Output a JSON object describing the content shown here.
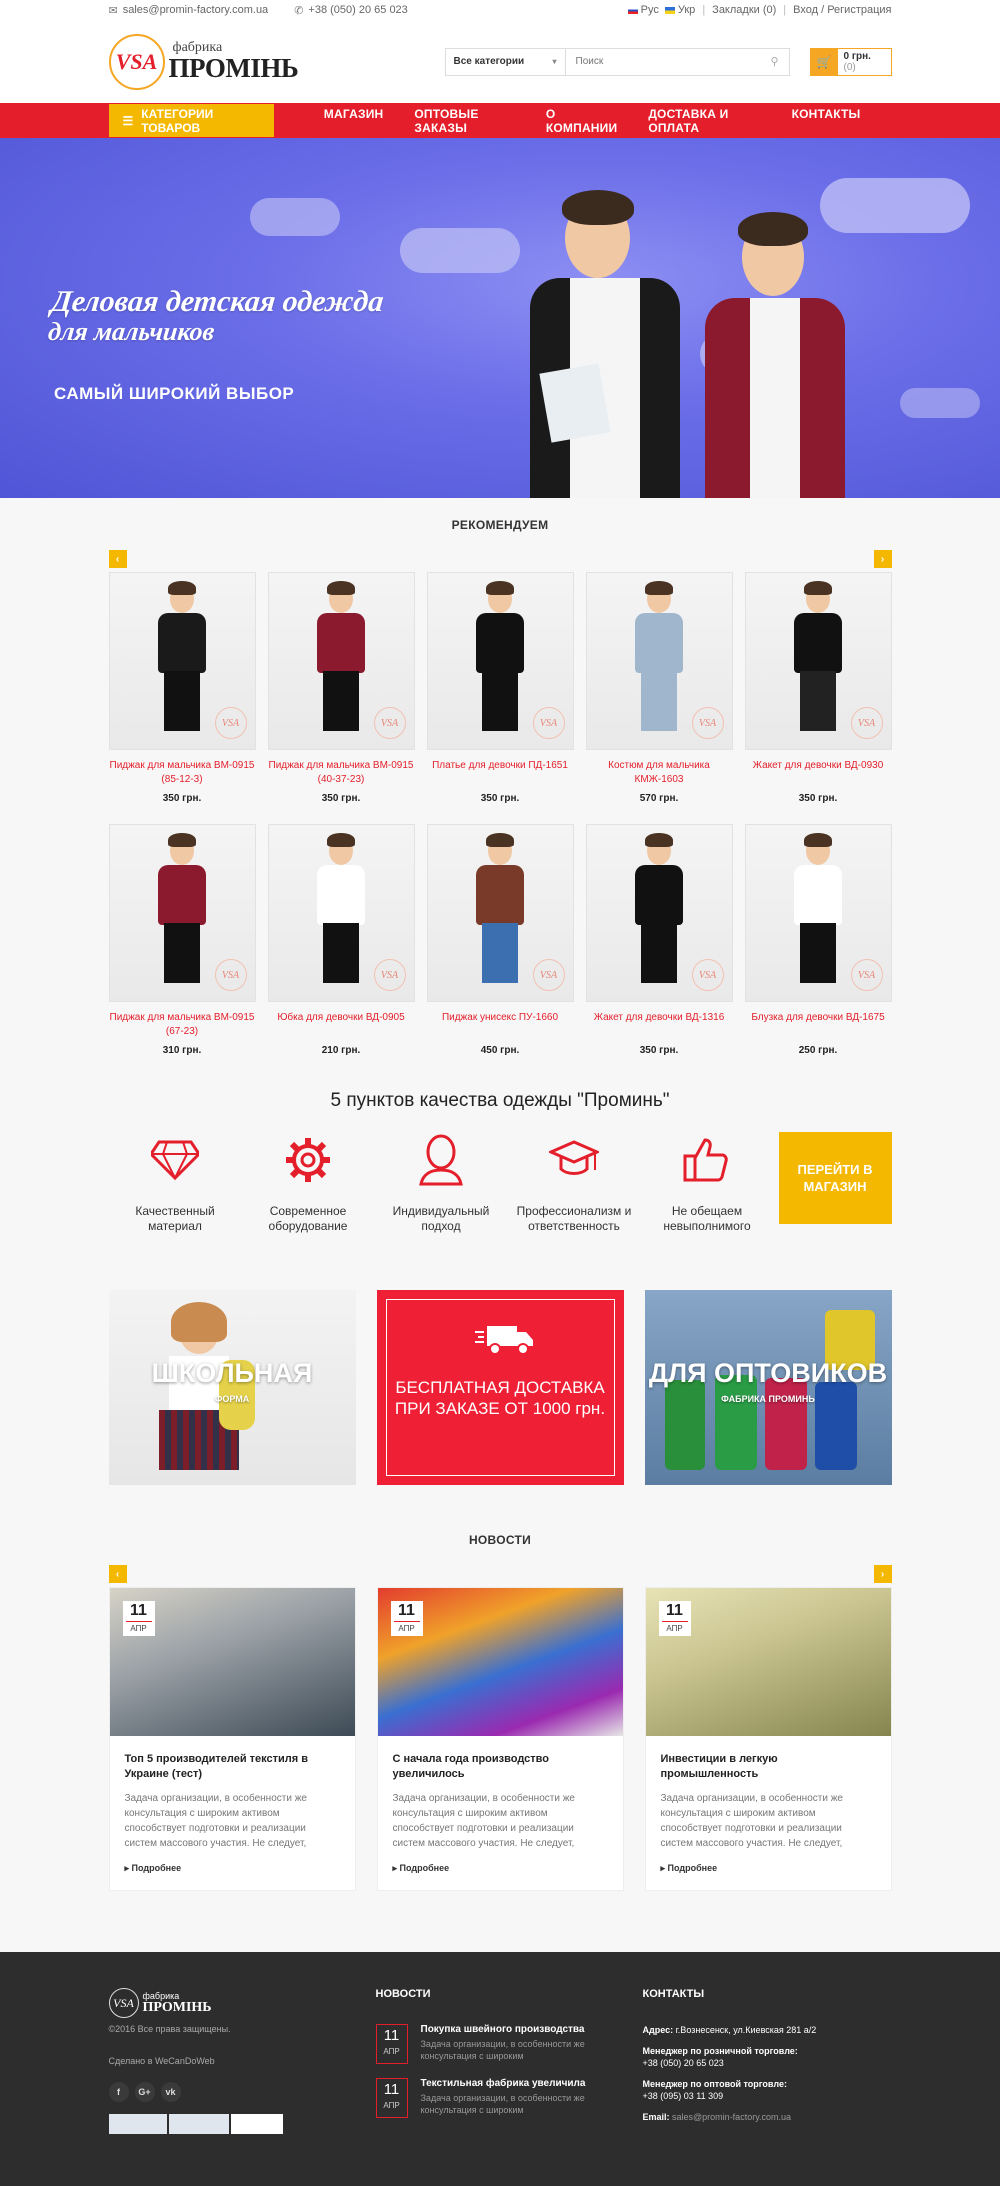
{
  "topbar": {
    "email": "sales@promin-factory.com.ua",
    "phone": "+38 (050) 20 65 023",
    "lang_ru": "Рус",
    "lang_ua": "Укр",
    "bookmarks": "Закладки (0)",
    "login": "Вход / Регистрация"
  },
  "header": {
    "logo_mark": "VSA",
    "logo_small": "фабрика",
    "logo_big": "ПРОМІНЬ",
    "search_category": "Все категории",
    "search_placeholder": "Поиск",
    "cart_total": "0 грн.",
    "cart_count": "(0)"
  },
  "nav": {
    "categories_label": "КАТЕГОРИИ ТОВАРОВ",
    "items": [
      "МАГАЗИН",
      "ОПТОВЫЕ ЗАКАЗЫ",
      "О КОМПАНИИ",
      "ДОСТАВКА И ОПЛАТА",
      "КОНТАКТЫ"
    ]
  },
  "hero": {
    "title_line1": "Деловая детская одежда",
    "title_line2": "для мальчиков",
    "subtitle": "САМЫЙ ШИРОКИЙ ВЫБОР"
  },
  "recommend": {
    "title": "РЕКОМЕНДУЕМ",
    "products": [
      {
        "name": "Пиджак для мальчика ВМ-0915 (85-12-3)",
        "price": "350 грн."
      },
      {
        "name": "Пиджак для мальчика ВМ-0915 (40-37-23)",
        "price": "350 грн."
      },
      {
        "name": "Платье для девочки ПД-1651",
        "price": "350 грн."
      },
      {
        "name": "Костюм для мальчика КМЖ-1603",
        "price": "570 грн."
      },
      {
        "name": "Жакет для девочки ВД-0930",
        "price": "350 грн."
      },
      {
        "name": "Пиджак для мальчика ВМ-0915 (67-23)",
        "price": "310 грн."
      },
      {
        "name": "Юбка для девочки ВД-0905",
        "price": "210 грн."
      },
      {
        "name": "Пиджак унисекс ПУ-1660",
        "price": "450 грн."
      },
      {
        "name": "Жакет для девочки ВД-1316",
        "price": "350 грн."
      },
      {
        "name": "Блузка для девочки ВД-1675",
        "price": "250 грн."
      }
    ]
  },
  "quality": {
    "title": "5 пунктов качества одежды \"Проминь\"",
    "items": [
      {
        "label": "Качественный материал",
        "icon": "diamond-icon"
      },
      {
        "label": "Современное оборудование",
        "icon": "gear-icon"
      },
      {
        "label": "Индивидуальный подход",
        "icon": "person-icon"
      },
      {
        "label": "Профессионализм и ответственность",
        "icon": "graduation-cap-icon"
      },
      {
        "label": "Не обещаем невыполнимого",
        "icon": "thumbs-up-icon"
      }
    ],
    "button": "ПЕРЕЙТИ В МАГАЗИН"
  },
  "banners": {
    "school_big": "ШКОЛЬНАЯ",
    "school_small": "ФОРМА",
    "delivery": "БЕСПЛАТНАЯ ДОСТАВКА ПРИ ЗАКАЗЕ ОТ 1000 грн.",
    "wholesale_big": "ДЛЯ ОПТОВИКОВ",
    "wholesale_small": "ФАБРИКА ПРОМИНЬ"
  },
  "news": {
    "title": "НОВОСТИ",
    "items": [
      {
        "day": "11",
        "month": "АПР",
        "title": "Топ 5 производителей текстиля в Украине (тест)",
        "text": "Задача организации, в особенности же консультация с широким активом способствует подготовки и реализации систем массового участия. Не следует, однако забывать,",
        "more": "Подробнее"
      },
      {
        "day": "11",
        "month": "АПР",
        "title": "С начала года производство увеличилось",
        "text": "Задача организации, в особенности же консультация с широким активом способствует подготовки и реализации систем массового участия. Не следует, однако забывать,",
        "more": "Подробнее"
      },
      {
        "day": "11",
        "month": "АПР",
        "title": "Инвестиции в легкую промышленность",
        "text": "Задача организации, в особенности же консультация с широким активом способствует подготовки и реализации систем массового участия. Не следует, однако забывать,",
        "more": "Подробнее"
      }
    ]
  },
  "footer": {
    "copyright": "©2016 Все права защищены.",
    "made_by": "Сделано в WeCanDoWeb",
    "social": [
      "f",
      "G+",
      "vk"
    ],
    "news_title": "НОВОСТИ",
    "news": [
      {
        "day": "11",
        "month": "АПР",
        "title": "Покупка швейного производства",
        "text": "Задача организации, в особенности же консультация с широким"
      },
      {
        "day": "11",
        "month": "АПР",
        "title": "Текстильная фабрика увеличила",
        "text": "Задача организации, в особенности же консультация с широким"
      }
    ],
    "contacts_title": "КОНТАКТЫ",
    "address_label": "Адрес:",
    "address": "г.Вознесенск, ул.Киевская 281 а/2",
    "retail_label": "Менеджер по розничной торговле:",
    "retail_phone": "+38 (050) 20 65 023",
    "wholesale_label": "Менеджер по оптовой торговле:",
    "wholesale_phone": "+38 (095) 03 11 309",
    "email_label": "Email:",
    "email": "sales@promin-factory.com.ua"
  },
  "colors": {
    "red": "#e41e2a",
    "yellow": "#f5b800",
    "footer_bg": "#2d2d2d"
  }
}
